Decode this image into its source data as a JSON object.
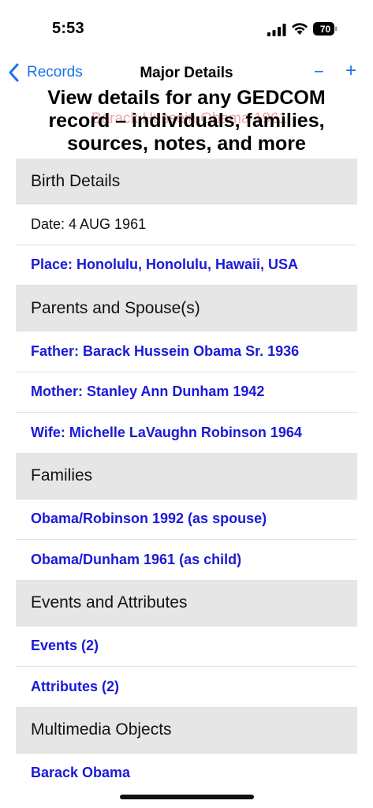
{
  "status": {
    "time": "5:53",
    "battery": "70"
  },
  "nav": {
    "back_label": "Records",
    "title": "Major Details",
    "minus": "−",
    "plus": "+"
  },
  "caption": {
    "line1": "View details for any GEDCOM",
    "line2": "record – individuals, families,",
    "line3": "sources, notes, and more",
    "faded_name": "Barack Hussein Obama 1961"
  },
  "sections": [
    {
      "header": "Birth Details",
      "rows": [
        {
          "text": "Date: 4 AUG 1961",
          "link": false
        },
        {
          "text": "Place: Honolulu, Honolulu, Hawaii, USA",
          "link": true
        }
      ]
    },
    {
      "header": "Parents and Spouse(s)",
      "rows": [
        {
          "text": "Father:  Barack Hussein Obama Sr. 1936",
          "link": true
        },
        {
          "text": "Mother:  Stanley Ann Dunham  1942",
          "link": true
        },
        {
          "text": "Wife:  Michelle LaVaughn Robinson  1964",
          "link": true
        }
      ]
    },
    {
      "header": "Families",
      "rows": [
        {
          "text": "Obama/Robinson 1992 (as spouse)",
          "link": true
        },
        {
          "text": "Obama/Dunham 1961 (as child)",
          "link": true
        }
      ]
    },
    {
      "header": "Events and Attributes",
      "rows": [
        {
          "text": "Events (2)",
          "link": true
        },
        {
          "text": "Attributes (2)",
          "link": true
        }
      ]
    },
    {
      "header": "Multimedia Objects",
      "rows": [
        {
          "text": "Barack Obama",
          "link": true
        }
      ]
    }
  ],
  "colors": {
    "accent": "#1a73e8",
    "link": "#1a1ad8",
    "section_bg": "#e6e6e6"
  }
}
